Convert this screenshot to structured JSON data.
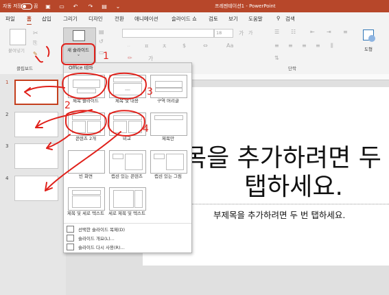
{
  "titlebar": {
    "autosave_label": "자동 저장",
    "autosave_state": "끔",
    "doc_title": "프레젠테이션1 - PowerPoint"
  },
  "tabs": [
    "파일",
    "홈",
    "삽입",
    "그리기",
    "디자인",
    "전환",
    "애니메이션",
    "슬라이드 쇼",
    "검토",
    "보기",
    "도움말",
    "검색"
  ],
  "active_tab": "홈",
  "ribbon": {
    "paste_label": "붙여넣기",
    "new_slide_label": "새 슬라이드",
    "clipboard_group": "클립보드",
    "paragraph_group": "단락",
    "font_size": "18",
    "shapes_label": "도형",
    "font_btn_1": "가",
    "font_btn_2": "가"
  },
  "gallery": {
    "header": "Office 테마",
    "layouts": [
      {
        "label": "제목 슬라이드"
      },
      {
        "label": "제목 및 내용"
      },
      {
        "label": "구역 머리글"
      },
      {
        "label": "콘텐츠 2개"
      },
      {
        "label": "비교"
      },
      {
        "label": "제목만"
      },
      {
        "label": "빈 화면"
      },
      {
        "label": "캡션 있는 콘텐츠"
      },
      {
        "label": "캡션 있는 그림"
      },
      {
        "label": "제목 및 세로 텍스트"
      },
      {
        "label": "세로 제목 및 텍스트"
      }
    ],
    "commands": [
      "선택한 슬라이드 복제(D)",
      "슬라이드 개요(L)...",
      "슬라이드 다시 사용(R)..."
    ]
  },
  "thumbnails": [
    "1",
    "2",
    "3",
    "4"
  ],
  "slide": {
    "title_line1": "목을 추가하려면 두",
    "title_line2": "탭하세요.",
    "subtitle": "부제목을 추가하려면 두 번 탭하세요."
  },
  "annotations": [
    "1",
    "2",
    "3",
    "4"
  ],
  "colors": {
    "accent": "#b7472a",
    "annotation": "#e0201a"
  }
}
